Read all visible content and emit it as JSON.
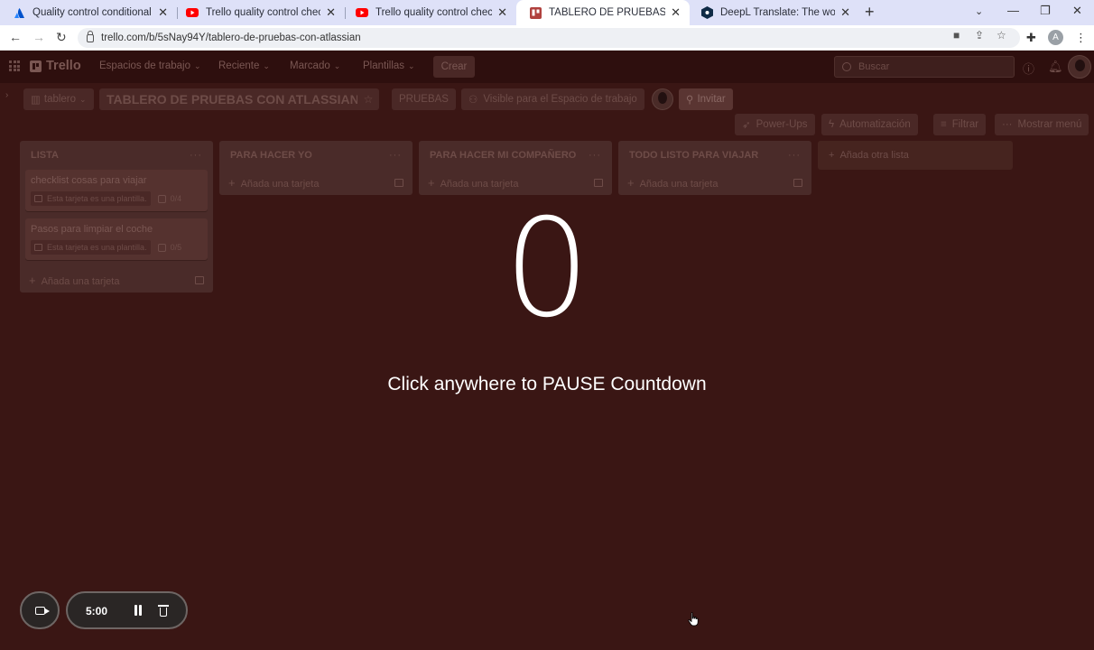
{
  "browser": {
    "tabs": [
      {
        "title": "Quality control conditional card",
        "favicon": "atlassian-icon",
        "active": false
      },
      {
        "title": "Trello quality control checklist - Y",
        "favicon": "youtube-icon",
        "active": false
      },
      {
        "title": "Trello quality control checklist - Y",
        "favicon": "youtube-icon",
        "active": false
      },
      {
        "title": "TABLERO DE PRUEBAS CON ATLA",
        "favicon": "trello-icon",
        "active": true
      },
      {
        "title": "DeepL Translate: The world's mo",
        "favicon": "deepl-icon",
        "active": false
      }
    ],
    "url": "trello.com/b/5sNay94Y/tablero-de-pruebas-con-atlassian",
    "profile_initial": "A"
  },
  "trello": {
    "logo": "Trello",
    "nav": {
      "workspaces": "Espacios de trabajo",
      "recent": "Reciente",
      "starred": "Marcado",
      "templates": "Plantillas",
      "create": "Crear"
    },
    "search_placeholder": "Buscar",
    "board": {
      "view": "tablero",
      "title": "TABLERO DE PRUEBAS CON ATLASSIAN",
      "workspace": "PRUEBAS",
      "visibility": "Visible para el Espacio de trabajo",
      "invite": "Invitar"
    },
    "actions": {
      "powerups": "Power-Ups",
      "automation": "Automatización",
      "filter": "Filtrar",
      "menu": "Mostrar menú"
    },
    "lists": [
      {
        "title": "LISTA",
        "cards": [
          {
            "title": "checklist cosas para viajar",
            "template_badge": "Esta tarjeta es una plantilla.",
            "checklist": "0/4"
          },
          {
            "title": "Pasos para limpiar el coche",
            "template_badge": "Esta tarjeta es una plantilla.",
            "checklist": "0/5"
          }
        ],
        "add_card": "Añada una tarjeta"
      },
      {
        "title": "PARA HACER YO",
        "cards": [],
        "add_card": "Añada una tarjeta"
      },
      {
        "title": "PARA HACER MI COMPAÑERO",
        "cards": [],
        "add_card": "Añada una tarjeta"
      },
      {
        "title": "TODO LISTO PARA VIAJAR",
        "cards": [],
        "add_card": "Añada una tarjeta"
      }
    ],
    "add_list": "Añada otra lista"
  },
  "overlay": {
    "countdown": "0",
    "message": "Click anywhere to PAUSE Countdown"
  },
  "recorder": {
    "time": "5:00"
  }
}
